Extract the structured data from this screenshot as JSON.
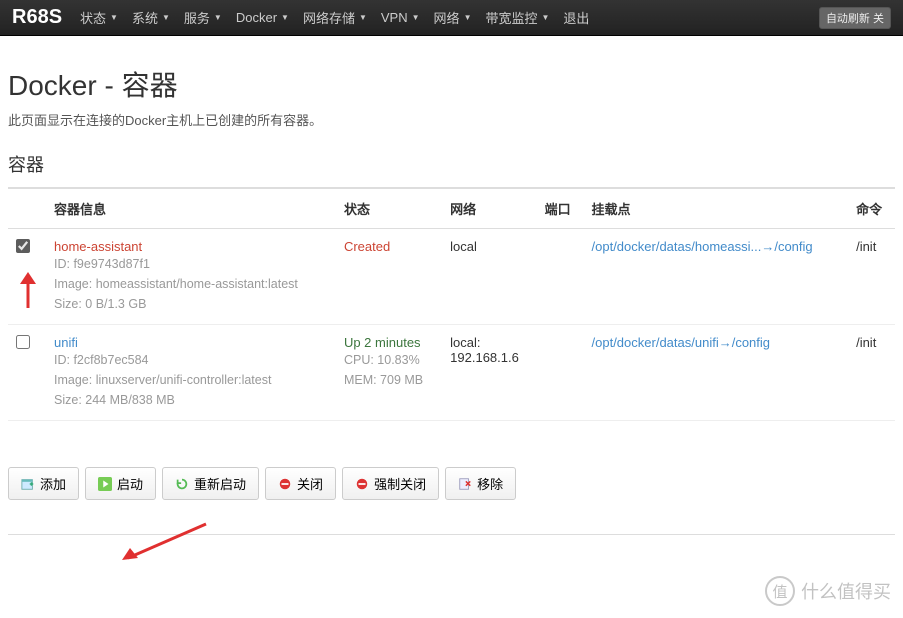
{
  "navbar": {
    "brand": "R68S",
    "items": [
      "状态",
      "系统",
      "服务",
      "Docker",
      "网络存储",
      "VPN",
      "网络",
      "带宽监控",
      "退出"
    ],
    "refresh": "自动刷新 关"
  },
  "page": {
    "title": "Docker - 容器",
    "desc": "此页面显示在连接的Docker主机上已创建的所有容器。",
    "section": "容器"
  },
  "table": {
    "headers": {
      "info": "容器信息",
      "status": "状态",
      "network": "网络",
      "ports": "端口",
      "mounts": "挂载点",
      "command": "命令"
    },
    "rows": [
      {
        "checked": true,
        "name": "home-assistant",
        "name_class": "red",
        "id_label": "ID: ",
        "id": "f9e9743d87f1",
        "image_label": "Image: ",
        "image": "homeassistant/home-assistant:latest",
        "size_label": "Size: ",
        "size": "0 B/1.3 GB",
        "status": "Created",
        "status_class": "created",
        "network": "local",
        "ip": "",
        "ports": "",
        "mount": "/opt/docker/datas/homeassi...→/config",
        "command": "/init"
      },
      {
        "checked": false,
        "name": "unifi",
        "name_class": "",
        "id_label": "ID: ",
        "id": "f2cf8b7ec584",
        "image_label": "Image: ",
        "image": "linuxserver/unifi-controller:latest",
        "size_label": "Size: ",
        "size": "244 MB/838 MB",
        "status": "Up 2 minutes",
        "status_cpu": "CPU: 10.83%",
        "status_mem": "MEM: 709 MB",
        "status_class": "up",
        "network": "local:",
        "ip": "192.168.1.6",
        "ports": "",
        "mount": "/opt/docker/datas/unifi→/config",
        "command": "/init"
      }
    ]
  },
  "actions": {
    "add": "添加",
    "start": "启动",
    "restart": "重新启动",
    "stop": "关闭",
    "kill": "强制关闭",
    "remove": "移除"
  },
  "watermark": {
    "badge": "值",
    "text": "什么值得买"
  }
}
